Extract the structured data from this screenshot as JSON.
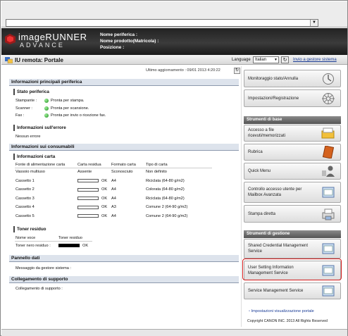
{
  "header": {
    "brand_line1": "imageRUNNER",
    "brand_line2": "ADVANCE",
    "device_name_label": "Nome periferica :",
    "product_name_label": "Nome prodotto(Matricola) :",
    "position_label": "Posizione :"
  },
  "subbar": {
    "title": "IU remota: Portale",
    "language_label": "Language",
    "language_value": "Italian",
    "to_sys_admin": "Invio a gestore sistema"
  },
  "main": {
    "last_updated": "Ultimo aggiornamento : 09/01 2013 4:20:22",
    "section_device_info": "Informazioni principali periferica",
    "device_status": {
      "title": "Stato periferica",
      "rows": [
        {
          "label": "Stampante :",
          "value": "Pronta per stampa."
        },
        {
          "label": "Scanner :",
          "value": "Pronta per scansione."
        },
        {
          "label": "Fax :",
          "value": "Pronta per invio o ricezione fax."
        }
      ]
    },
    "error_info": {
      "title": "Informazioni sull'errore",
      "value": "Nessun errore"
    },
    "section_consumables": "Informazioni sui consumabili",
    "paper_info": {
      "title": "Informazioni carta",
      "headers": [
        "Fonte di alimentazione carta",
        "Carta residua",
        "Formato carta",
        "Tipo di carta"
      ],
      "rows": [
        {
          "source": "Vassoio multiuso",
          "remaining": "Assente",
          "level": null,
          "size": "Sconosciuto",
          "type": "Non definito"
        },
        {
          "source": "Cassetto 1",
          "remaining": "OK",
          "level": 0,
          "size": "A4",
          "type": "Riciclata (64-80 g/m2)"
        },
        {
          "source": "Cassetto 2",
          "remaining": "OK",
          "level": 0,
          "size": "A4",
          "type": "Colorata (64-80 g/m2)"
        },
        {
          "source": "Cassetto 3",
          "remaining": "OK",
          "level": 0,
          "size": "A4",
          "type": "Riciclata (64-80 g/m2)"
        },
        {
          "source": "Cassetto 4",
          "remaining": "OK",
          "level": 0,
          "size": "A3",
          "type": "Comune 2 (64-90 g/m2)"
        },
        {
          "source": "Cassetto 5",
          "remaining": "OK",
          "level": 0,
          "size": "A4",
          "type": "Comune 2 (64-90 g/m2)"
        }
      ]
    },
    "toner": {
      "title": "Toner residuo",
      "headers": [
        "Nome voce",
        "Toner residuo"
      ],
      "label": "Toner nero residuo :",
      "value": "OK",
      "level": 1.0
    },
    "data_panel": {
      "title": "Pannello dati",
      "label": "Messaggio da gestore sistema :"
    },
    "support": {
      "title": "Collegamento di supporto",
      "label": "Collegamento di supporto :"
    }
  },
  "right": {
    "top_buttons": [
      "Monitoraggio stato/Annulla",
      "Impostazioni/Registrazione"
    ],
    "basic_tools_header": "Strumenti di base",
    "basic_tools": [
      "Accesso a file ricevuti/memorizzati",
      "Rubrica",
      "Quick Menu",
      "Controllo accesso utente per Mailbox Avanzata",
      "Stampa diretta"
    ],
    "mgmt_tools_header": "Strumenti di gestione",
    "mgmt_tools": [
      "Shared Credential Management Service",
      "User Setting Information Management Service",
      "Service Management Service"
    ],
    "portal_settings_link": "Impostazioni visualizzazione portale",
    "copyright": "Copyright CANON INC. 2013 All Rights Reserved"
  },
  "colors": {
    "accent_link": "#1a3c96",
    "highlight": "#d41a1a",
    "status_ok": "#1b8a1b"
  }
}
